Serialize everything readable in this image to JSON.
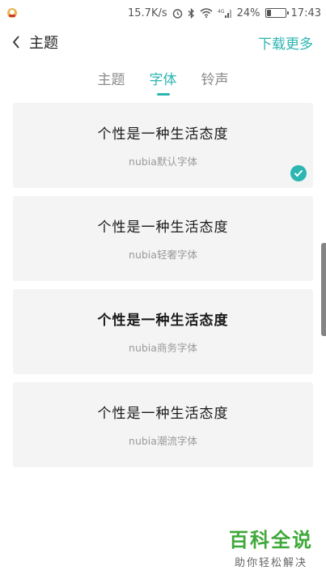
{
  "status_bar": {
    "network_speed": "15.7K/s",
    "battery_percent": "24%",
    "battery_level": 0.24,
    "time": "17:43",
    "signal_label": "4G"
  },
  "header": {
    "title": "主题",
    "action": "下载更多"
  },
  "tabs": [
    {
      "label": "主题",
      "active": false
    },
    {
      "label": "字体",
      "active": true
    },
    {
      "label": "铃声",
      "active": false
    }
  ],
  "font_list": [
    {
      "sample": "个性是一种生活态度",
      "name": "nubia默认字体",
      "selected": true
    },
    {
      "sample": "个性是一种生活态度",
      "name": "nubia轻奢字体",
      "selected": false
    },
    {
      "sample": "个性是一种生活态度",
      "name": "nubia商务字体",
      "selected": false
    },
    {
      "sample": "个性是一种生活态度",
      "name": "nubia潮流字体",
      "selected": false
    }
  ],
  "watermark": {
    "main": "百科全说",
    "sub": "助你轻松解决"
  },
  "colors": {
    "accent": "#2cb6b2",
    "card_bg": "#f4f4f4",
    "watermark_green": "#3fa83a"
  }
}
